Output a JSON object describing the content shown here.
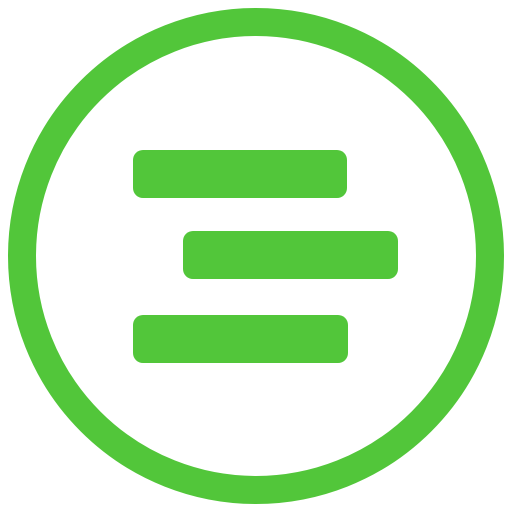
{
  "icon": {
    "name": "staggered-lines-circle-icon",
    "colors": {
      "accent": "#52C63A",
      "background": "#FFFFFF"
    }
  }
}
